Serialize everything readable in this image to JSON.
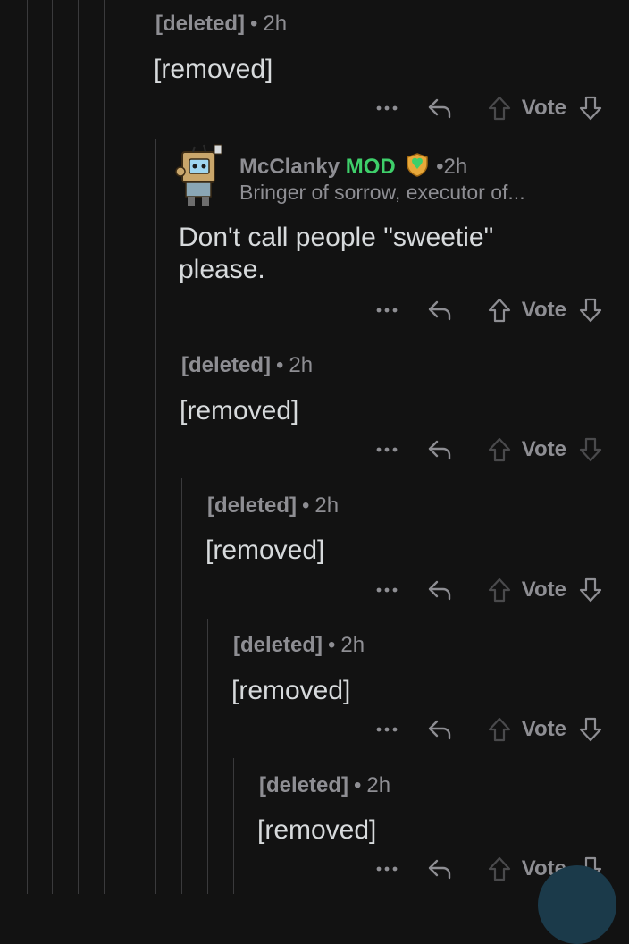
{
  "comments": [
    {
      "author": "[deleted]",
      "separator": "•",
      "time": "2h",
      "body": "[removed]"
    },
    {
      "author": "McClanky",
      "mod_label": "MOD",
      "separator": "•",
      "time": "2h",
      "flair": "Bringer of sorrow, executor of...",
      "body_lines": [
        "Don't call people \"sweetie\"",
        "please."
      ]
    },
    {
      "author": "[deleted]",
      "separator": "•",
      "time": "2h",
      "body": "[removed]"
    },
    {
      "author": "[deleted]",
      "separator": "•",
      "time": "2h",
      "body": "[removed]"
    },
    {
      "author": "[deleted]",
      "separator": "•",
      "time": "2h",
      "body": "[removed]"
    },
    {
      "author": "[deleted]",
      "separator": "•",
      "time": "2h",
      "body": "[removed]"
    }
  ],
  "actions": {
    "vote_label": "Vote",
    "more_icon": "more-dots-icon",
    "reply_icon": "reply-arrow-icon",
    "upvote_icon": "upvote-arrow-icon",
    "downvote_icon": "downvote-arrow-icon"
  },
  "colors": {
    "background": "#121212",
    "text": "#d7dadc",
    "muted": "#8e8e93",
    "mod_green": "#3ecf6a",
    "thread_line": "#3a3a3c"
  }
}
